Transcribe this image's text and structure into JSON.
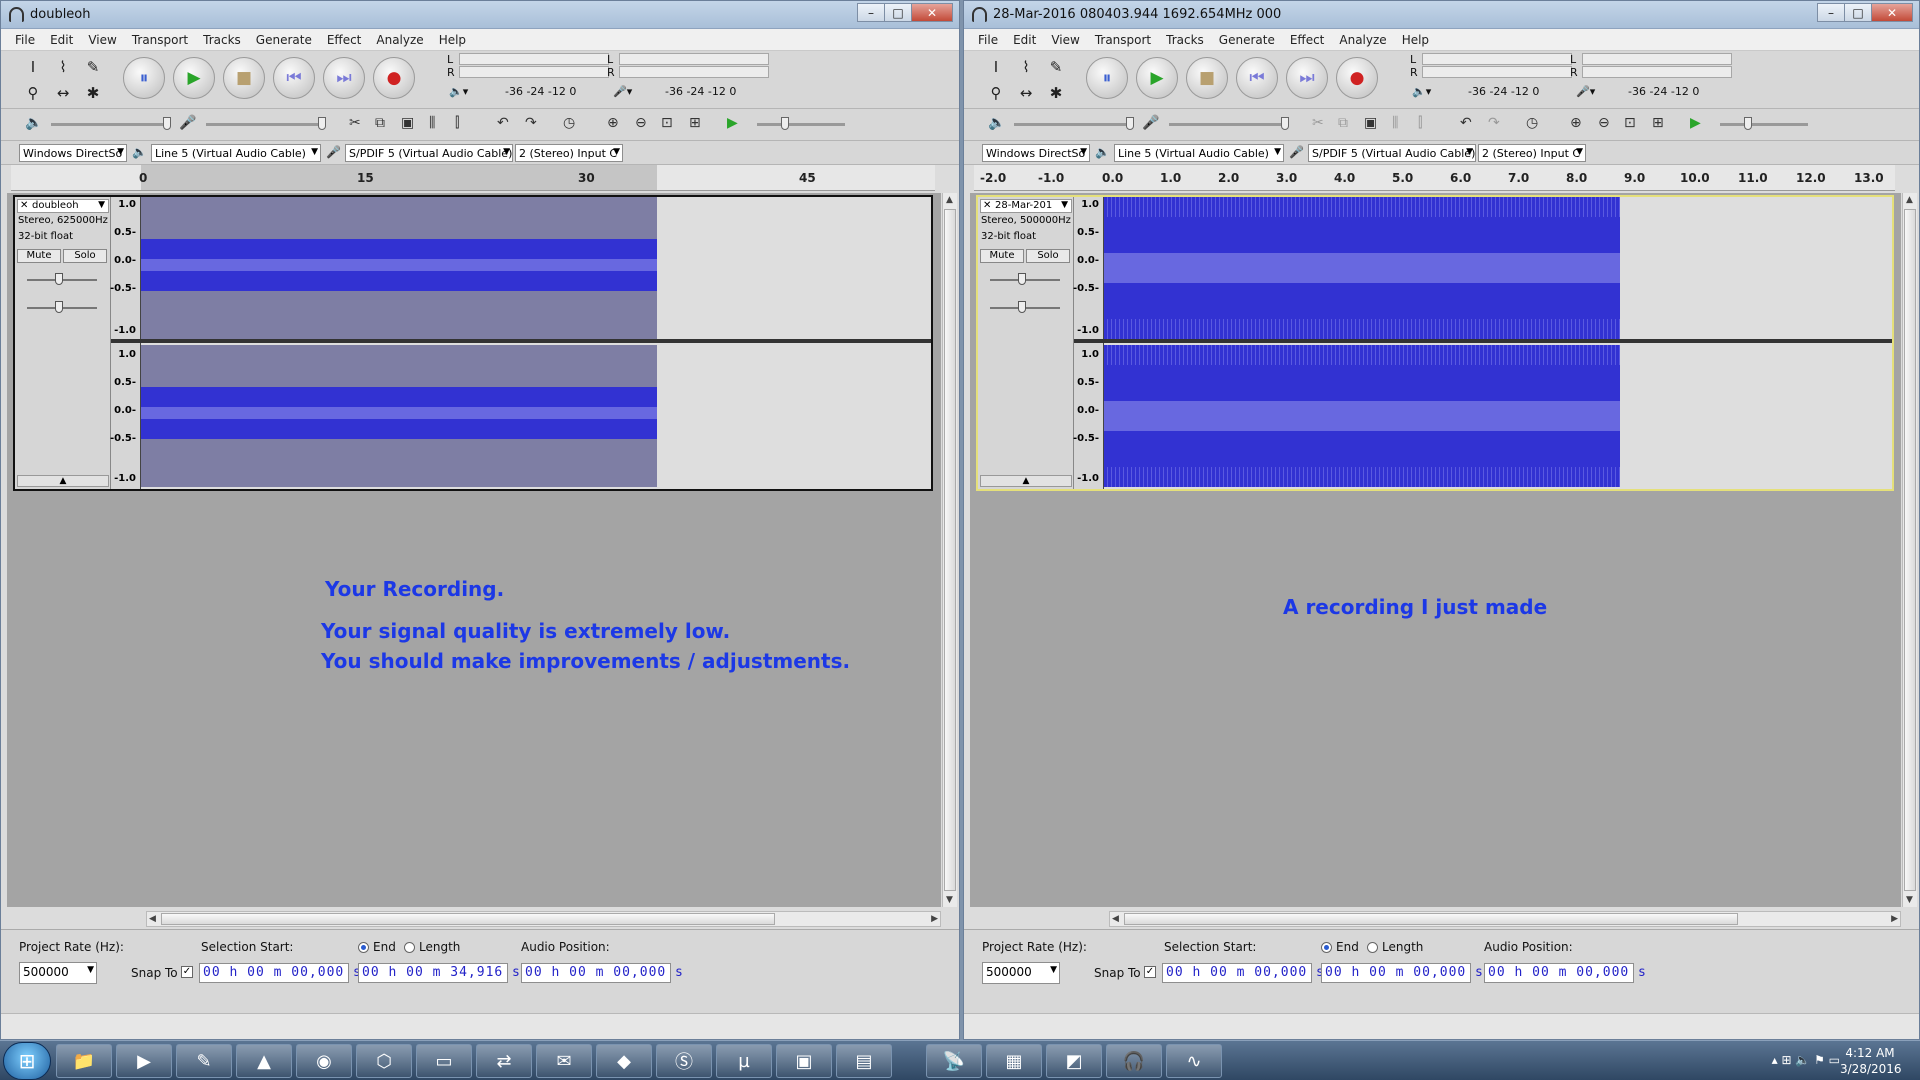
{
  "menus": [
    "File",
    "Edit",
    "View",
    "Transport",
    "Tracks",
    "Generate",
    "Effect",
    "Analyze",
    "Help"
  ],
  "meter": {
    "l": "L",
    "r": "R",
    "scale_left": "-36  -24  -12   0",
    "scale_right": "-36  -24  -12   0"
  },
  "devices": {
    "host": "Windows DirectSo",
    "playback": "Line 5 (Virtual Audio Cable)",
    "recording": "S/PDIF 5 (Virtual Audio Cable)",
    "channels": "2 (Stereo) Input C"
  },
  "vscale": [
    "1.0",
    "0.5-",
    "0.0-",
    "-0.5-",
    "-1.0"
  ],
  "labels": {
    "mute": "Mute",
    "solo": "Solo",
    "project_rate": "Project Rate (Hz):",
    "snap_to": "Snap To",
    "selection_start": "Selection Start:",
    "end": "End",
    "length": "Length",
    "audio_position": "Audio Position:"
  },
  "left": {
    "title": "doubleoh",
    "ruler": [
      "0",
      "15",
      "30",
      "45"
    ],
    "track_name": "doubleoh",
    "track_info1": "Stereo, 625000Hz",
    "track_info2": "32-bit float",
    "overlay1": "Your Recording.",
    "overlay2": "Your signal quality is extremely low.",
    "overlay3": "You should make improvements / adjustments.",
    "project_rate": "500000",
    "sel_start": "00 h 00 m 00,000 s",
    "sel_end": "00 h 00 m 34,916 s",
    "audio_pos": "00 h 00 m 00,000 s"
  },
  "right": {
    "title": "28-Mar-2016 080403.944 1692.654MHz 000",
    "ruler": [
      "-2.0",
      "-1.0",
      "0.0",
      "1.0",
      "2.0",
      "3.0",
      "4.0",
      "5.0",
      "6.0",
      "7.0",
      "8.0",
      "9.0",
      "10.0",
      "11.0",
      "12.0",
      "13.0"
    ],
    "track_name": "28-Mar-201",
    "track_info1": "Stereo, 500000Hz",
    "track_info2": "32-bit float",
    "overlay1": "A recording I just made",
    "project_rate": "500000",
    "sel_start": "00 h 00 m 00,000 s",
    "sel_end": "00 h 00 m 00,000 s",
    "audio_pos": "00 h 00 m 00,000 s"
  },
  "clock": {
    "time": "4:12 AM",
    "date": "3/28/2016"
  },
  "icons": {
    "pause": "⏸",
    "play": "▶",
    "stop": "■",
    "skip_start": "⏮",
    "skip_end": "⏭",
    "record": "●",
    "close": "✕",
    "minimize": "–",
    "maximize": "□"
  },
  "colors": {
    "wave": "#3232d2",
    "wave_rms": "#6868e0",
    "selection": "#7e7ea4",
    "overlay_text": "#1c38e6"
  }
}
